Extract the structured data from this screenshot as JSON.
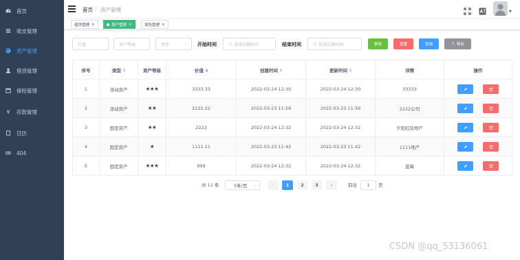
{
  "sidebar": {
    "items": [
      {
        "label": "首页",
        "icon": "dashboard-icon",
        "active": false
      },
      {
        "label": "收支管理",
        "icon": "list-icon",
        "active": false
      },
      {
        "label": "资产管理",
        "icon": "chart-icon",
        "active": true
      },
      {
        "label": "借贷管理",
        "icon": "user-icon",
        "active": false
      },
      {
        "label": "保险管理",
        "icon": "calendar-icon",
        "active": false
      },
      {
        "label": "存款管理",
        "icon": "yen-icon",
        "active": false
      },
      {
        "label": "日历",
        "icon": "doc-icon",
        "active": false
      },
      {
        "label": "404",
        "icon": "error-icon",
        "active": false
      }
    ]
  },
  "breadcrumb": {
    "home": "首页",
    "sep": "/",
    "current": "资产管理"
  },
  "tags": [
    {
      "label": "借贷管理",
      "active": false
    },
    {
      "label": "资产管理",
      "active": true
    },
    {
      "label": "保险管理",
      "active": false
    }
  ],
  "filters": {
    "value_placeholder": "价值",
    "level_placeholder": "资产等级",
    "type_placeholder": "类型",
    "start_label": "开始时间",
    "start_placeholder": "选择日期时间",
    "end_label": "结束时间",
    "end_placeholder": "选择日期时间"
  },
  "buttons": {
    "add": "新增",
    "reset": "重置",
    "query": "查询",
    "export": "导出"
  },
  "colors": {
    "sidebar_bg": "#304156",
    "active_tag": "#42b983",
    "primary": "#409eff",
    "danger": "#f56c6c",
    "success": "#67c23a",
    "info": "#909399"
  },
  "table": {
    "headers": [
      "序号",
      "类型",
      "资产等级",
      "价值",
      "创建时间",
      "更新时间",
      "详情",
      "操作"
    ],
    "rows": [
      {
        "no": "1",
        "type": "流动资产",
        "stars": 3,
        "value": "3333.33",
        "created": "2022-03-24 12:30",
        "updated": "2022-03-24 12:30",
        "detail": "33333"
      },
      {
        "no": "2",
        "type": "流动资产",
        "stars": 2,
        "value": "2222.22",
        "created": "2022-03-23 11:56",
        "updated": "2022-03-23 11:56",
        "detail": "2222公司"
      },
      {
        "no": "3",
        "type": "固定资产",
        "stars": 2,
        "value": "2222",
        "created": "2022-03-24 12:32",
        "updated": "2022-03-24 12:32",
        "detail": "夕阳红房地产"
      },
      {
        "no": "4",
        "type": "固定资产",
        "stars": 1,
        "value": "1111.11",
        "created": "2022-03-23 11:42",
        "updated": "2022-03-23 11:42",
        "detail": "1111地产"
      },
      {
        "no": "5",
        "type": "固定资产",
        "stars": 3,
        "value": "999",
        "created": "2022-03-24 12:32",
        "updated": "2022-03-24 12:32",
        "detail": "蓝莓"
      }
    ]
  },
  "pagination": {
    "total": "共 11 条",
    "page_size": "5条/页",
    "pages": [
      "1",
      "2",
      "3"
    ],
    "current_page": 1,
    "goto_label": "前往",
    "goto_value": "1",
    "page_unit": "页"
  },
  "watermark": "CSDN @qq_53136061"
}
